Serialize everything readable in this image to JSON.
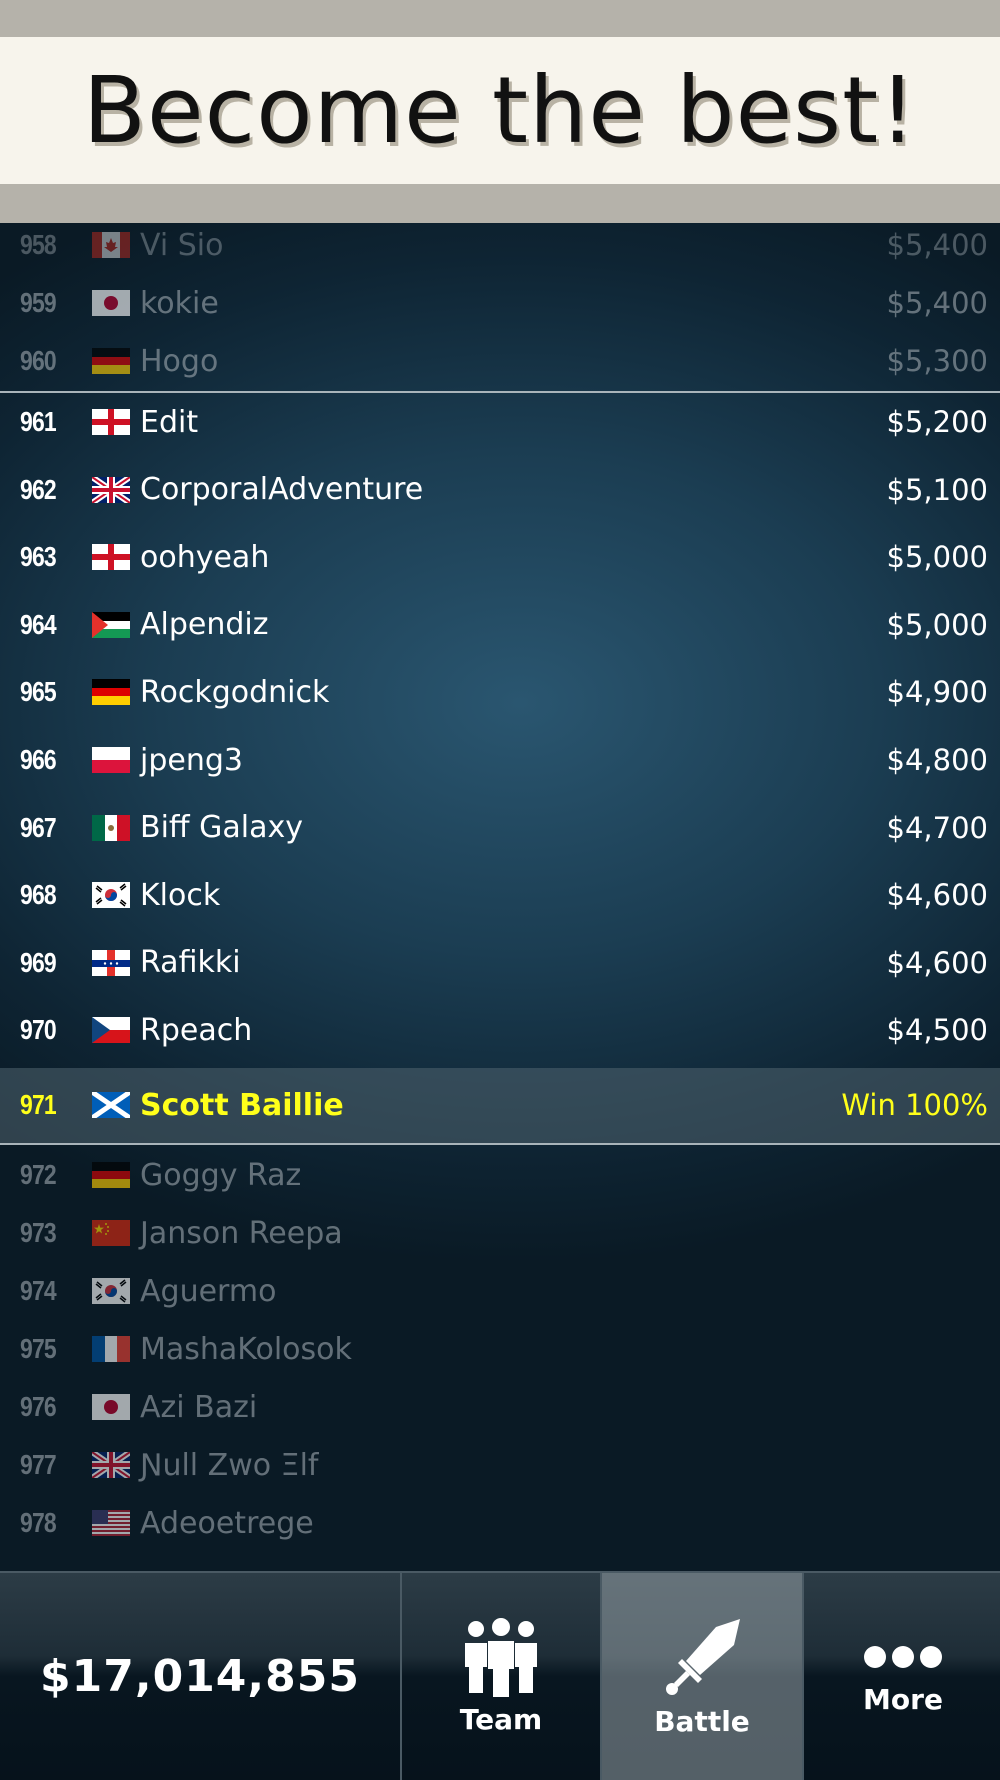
{
  "banner": {
    "title": "Become the best!"
  },
  "leaderboard": {
    "above": [
      {
        "rank": "958",
        "flag": "canada",
        "name": "Vi Sio",
        "score": "$5,400"
      },
      {
        "rank": "959",
        "flag": "japan",
        "name": "kokie",
        "score": "$5,400"
      },
      {
        "rank": "960",
        "flag": "germany",
        "name": "Hogo",
        "score": "$5,300"
      }
    ],
    "main": [
      {
        "rank": "961",
        "flag": "england",
        "name": "Edit",
        "score": "$5,200"
      },
      {
        "rank": "962",
        "flag": "uk",
        "name": "CorporalAdventure",
        "score": "$5,100"
      },
      {
        "rank": "963",
        "flag": "england",
        "name": "oohyeah",
        "score": "$5,000"
      },
      {
        "rank": "964",
        "flag": "palestine",
        "name": "Alpendiz",
        "score": "$5,000"
      },
      {
        "rank": "965",
        "flag": "germany",
        "name": "Rockgodnick",
        "score": "$4,900"
      },
      {
        "rank": "966",
        "flag": "poland",
        "name": "jpeng3",
        "score": "$4,800"
      },
      {
        "rank": "967",
        "flag": "mexico",
        "name": "Biff Galaxy",
        "score": "$4,700"
      },
      {
        "rank": "968",
        "flag": "south-korea",
        "name": "Klock",
        "score": "$4,600"
      },
      {
        "rank": "969",
        "flag": "netherlands-antilles",
        "name": "Rafikki",
        "score": "$4,600"
      },
      {
        "rank": "970",
        "flag": "czech",
        "name": "Rpeach",
        "score": "$4,500"
      }
    ],
    "me": {
      "rank": "971",
      "flag": "scotland",
      "name": "Scott Baillie",
      "score": "Win 100%"
    },
    "below": [
      {
        "rank": "972",
        "flag": "germany",
        "name": "Goggy Raz"
      },
      {
        "rank": "973",
        "flag": "china",
        "name": "Janson Reepa"
      },
      {
        "rank": "974",
        "flag": "south-korea",
        "name": "Aguermo"
      },
      {
        "rank": "975",
        "flag": "france",
        "name": "MashaKolosok"
      },
      {
        "rank": "976",
        "flag": "japan",
        "name": "Azi Bazi"
      },
      {
        "rank": "977",
        "flag": "uk",
        "name": "Ɲull Zwo Ξlf"
      },
      {
        "rank": "978",
        "flag": "usa",
        "name": "Adeoetrege"
      }
    ]
  },
  "footer": {
    "cash": "$17,014,855",
    "nav": [
      {
        "label": "Team",
        "icon": "team-icon"
      },
      {
        "label": "Battle",
        "icon": "sword-icon",
        "active": true
      },
      {
        "label": "More",
        "icon": "more-dots-icon"
      }
    ]
  }
}
